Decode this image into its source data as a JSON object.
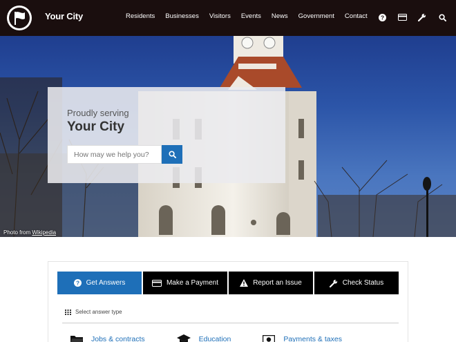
{
  "header": {
    "title": "Your City",
    "nav": [
      "Residents",
      "Businesses",
      "Visitors",
      "Events",
      "News",
      "Government",
      "Contact"
    ]
  },
  "hero": {
    "serving": "Proudly serving",
    "city": "Your City",
    "search_placeholder": "How may we help you?",
    "credit_prefix": "Photo from ",
    "credit_link": "Wikipedia"
  },
  "tabs": [
    {
      "label": "Get Answers",
      "icon": "question-icon",
      "active": true
    },
    {
      "label": "Make a Payment",
      "icon": "credit-card-icon",
      "active": false
    },
    {
      "label": "Report an Issue",
      "icon": "warning-icon",
      "active": false
    },
    {
      "label": "Check Status",
      "icon": "wrench-icon",
      "active": false
    }
  ],
  "answer_type_label": "Select answer type",
  "categories": [
    {
      "label": "Jobs & contracts",
      "icon": "folder-icon"
    },
    {
      "label": "Education",
      "icon": "graduation-cap-icon"
    },
    {
      "label": "Payments & taxes",
      "icon": "money-icon"
    }
  ],
  "colors": {
    "header_bg": "#1a0e0e",
    "accent": "#1e6fb8",
    "tab_bg": "#000000"
  }
}
